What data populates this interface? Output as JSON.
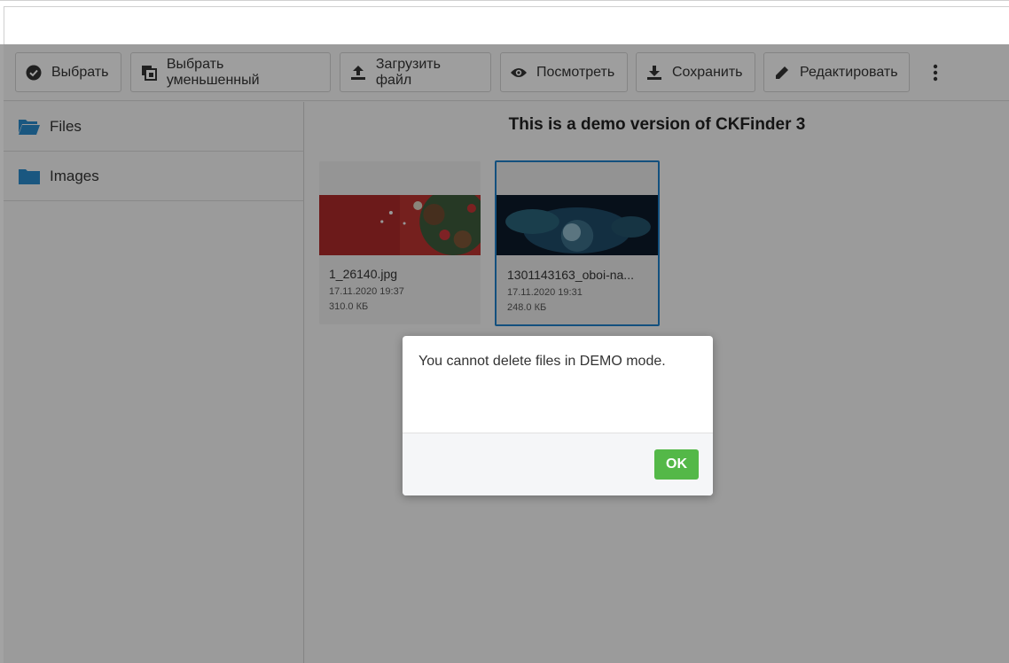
{
  "toolbar": {
    "buttons": [
      {
        "label": "Выбрать",
        "icon": "check-circle-icon"
      },
      {
        "label": "Выбрать уменьшенный",
        "icon": "images-icon"
      },
      {
        "label": "Загрузить файл",
        "icon": "upload-icon"
      },
      {
        "label": "Посмотреть",
        "icon": "eye-icon"
      },
      {
        "label": "Сохранить",
        "icon": "download-icon"
      },
      {
        "label": "Редактировать",
        "icon": "pencil-icon"
      }
    ],
    "more_icon": "more-vertical-icon"
  },
  "sidebar": {
    "folders": [
      {
        "label": "Files",
        "icon": "folder-open-icon"
      },
      {
        "label": "Images",
        "icon": "folder-icon"
      }
    ]
  },
  "main": {
    "demo_title": "This is a demo version of CKFinder 3",
    "files": [
      {
        "name": "1_26140.jpg",
        "date": "17.11.2020 19:37",
        "size": "310.0 КБ",
        "selected": false
      },
      {
        "name": "1301143163_oboi-na...",
        "date": "17.11.2020 19:31",
        "size": "248.0 КБ",
        "selected": true
      }
    ]
  },
  "dialog": {
    "message": "You cannot delete files in DEMO mode.",
    "ok_label": "OK"
  },
  "colors": {
    "accent_blue": "#1f7ec6",
    "ok_green": "#54b848",
    "folder_blue": "#2a88c8"
  }
}
